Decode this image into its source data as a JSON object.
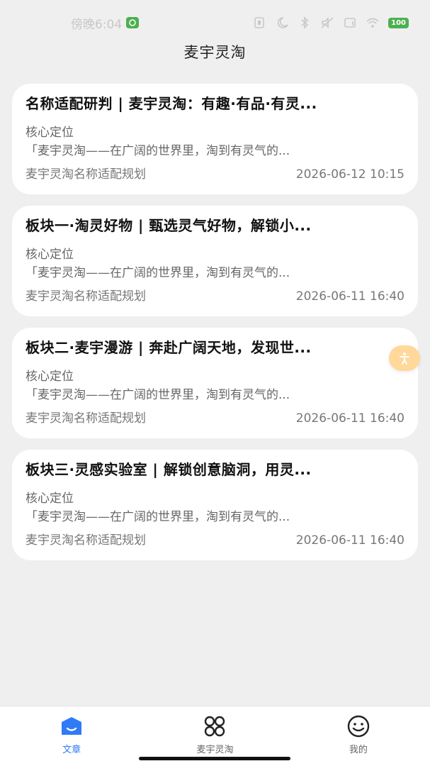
{
  "status_bar": {
    "time": "傍晚6:04",
    "battery": "100"
  },
  "header": {
    "title": "麦宇灵淘"
  },
  "articles": [
    {
      "title": "名称适配研判 | 麦宇灵淘：有趣·有品·有灵...",
      "section": "核心定位",
      "excerpt": "「麦宇灵淘——在广阔的世界里，淘到有灵气的...",
      "category": "麦宇灵淘名称适配规划",
      "date": "2026-06-12 10:15"
    },
    {
      "title": "板块一·淘灵好物 | 甄选灵气好物，解锁小...",
      "section": "核心定位",
      "excerpt": "「麦宇灵淘——在广阔的世界里，淘到有灵气的...",
      "category": "麦宇灵淘名称适配规划",
      "date": "2026-06-11 16:40"
    },
    {
      "title": "板块二·麦宇漫游 | 奔赴广阔天地，发现世...",
      "section": "核心定位",
      "excerpt": "「麦宇灵淘——在广阔的世界里，淘到有灵气的...",
      "category": "麦宇灵淘名称适配规划",
      "date": "2026-06-11 16:40"
    },
    {
      "title": "板块三·灵感实验室 | 解锁创意脑洞，用灵...",
      "section": "核心定位",
      "excerpt": "「麦宇灵淘——在广阔的世界里，淘到有灵气的...",
      "category": "麦宇灵淘名称适配规划",
      "date": "2026-06-11 16:40"
    }
  ],
  "tabbar": {
    "tabs": [
      {
        "label": "文章",
        "icon": "article-icon"
      },
      {
        "label": "麦宇灵淘",
        "icon": "grid-icon"
      },
      {
        "label": "我的",
        "icon": "smiley-icon"
      }
    ],
    "active_color": "#2f7bf6"
  },
  "accessibility_button": {
    "icon": "accessibility-icon",
    "color": "#ffd89a"
  }
}
